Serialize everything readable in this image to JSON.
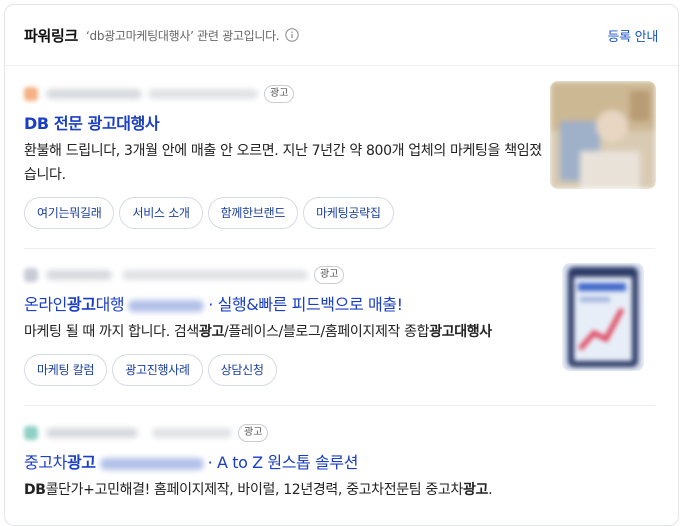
{
  "header": {
    "title": "파워링크",
    "description": "‘db광고마케팅대행사’ 관련 광고입니다.",
    "register_link": "등록 안내"
  },
  "badge_label": "광고",
  "ads": [
    {
      "title": "DB 전문 광고대행사",
      "description": "환불해 드립니다, 3개월 안에 매출 안 오르면. 지난 7년간 약 800개 업체의 마케팅을 책임졌습니다.",
      "chips": [
        "여기는뭐길래",
        "서비스 소개",
        "함께한브랜드",
        "마케팅공략집"
      ]
    },
    {
      "title_prefix": "온라인",
      "title_bold": "광고",
      "title_mid": "대행",
      "title_suffix": "· 실행&빠른 피드백으로 매출!",
      "desc_1": "마케팅 될 때 까지 합니다. 검색",
      "desc_2": "광고",
      "desc_3": "/플레이스/블로그/홈페이지제작 종합",
      "desc_4": "광고대행사",
      "chips": [
        "마케팅 칼럼",
        "광고진행사례",
        "상담신청"
      ]
    },
    {
      "title_prefix": "중고차",
      "title_bold": "광고",
      "title_suffix": "· A to Z 원스톱 솔루션",
      "desc_1": "DB",
      "desc_2": "콜단가+고민해결! 홈페이지제작, 바이럴, 12년경력, 중고차전문팀 중고차",
      "desc_3": "광고",
      "desc_4": "."
    }
  ],
  "colors": {
    "title_link": "#1a3ec4",
    "register_link": "#1a55c4",
    "chip_text": "#1a3e9e",
    "border": "#e3e5e8"
  }
}
